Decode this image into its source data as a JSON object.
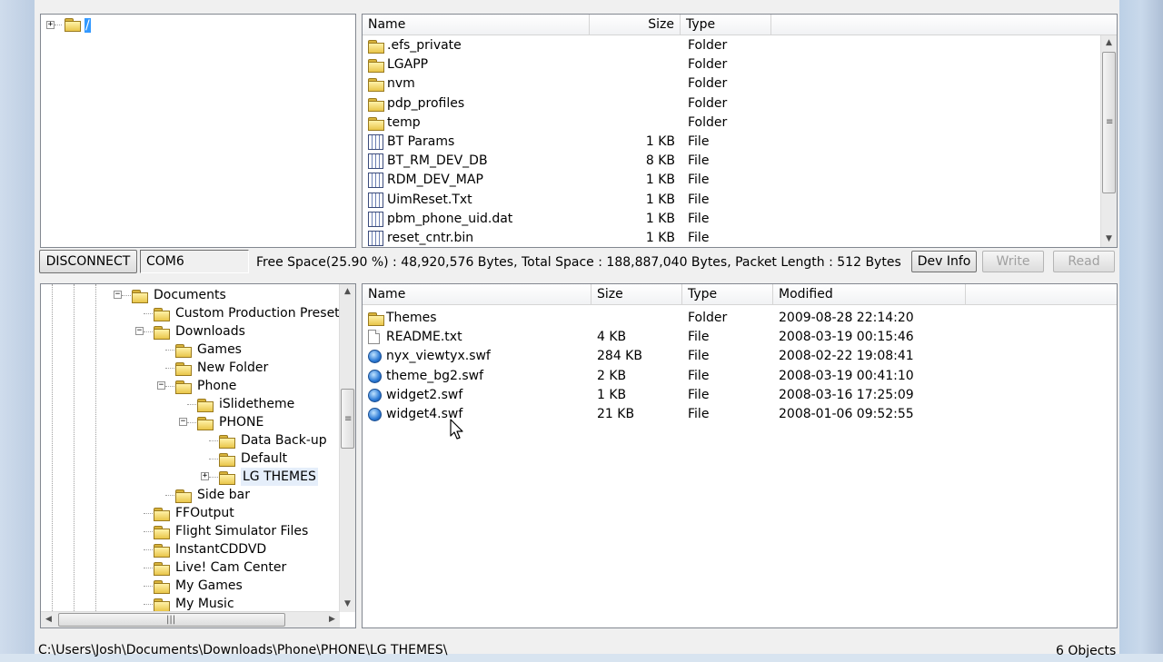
{
  "device_tree": {
    "root_label": "/"
  },
  "device_list": {
    "columns": [
      "Name",
      "Size",
      "Type"
    ],
    "rows": [
      {
        "name": ".efs_private",
        "size": "",
        "type": "Folder",
        "icon": "folder-icon"
      },
      {
        "name": "LGAPP",
        "size": "",
        "type": "Folder",
        "icon": "folder-icon"
      },
      {
        "name": "nvm",
        "size": "",
        "type": "Folder",
        "icon": "folder-icon"
      },
      {
        "name": "pdp_profiles",
        "size": "",
        "type": "Folder",
        "icon": "folder-icon"
      },
      {
        "name": "temp",
        "size": "",
        "type": "Folder",
        "icon": "folder-icon"
      },
      {
        "name": "BT Params",
        "size": "1 KB",
        "type": "File",
        "icon": "system-file-icon"
      },
      {
        "name": "BT_RM_DEV_DB",
        "size": "8 KB",
        "type": "File",
        "icon": "system-file-icon"
      },
      {
        "name": "RDM_DEV_MAP",
        "size": "1 KB",
        "type": "File",
        "icon": "system-file-icon"
      },
      {
        "name": "UimReset.Txt",
        "size": "1 KB",
        "type": "File",
        "icon": "system-file-icon"
      },
      {
        "name": "pbm_phone_uid.dat",
        "size": "1 KB",
        "type": "File",
        "icon": "system-file-icon"
      },
      {
        "name": "reset_cntr.bin",
        "size": "1 KB",
        "type": "File",
        "icon": "system-file-icon"
      }
    ]
  },
  "status_bar": {
    "disconnect_label": "DISCONNECT",
    "port": "COM6",
    "space_info": "Free Space(25.90 %) : 48,920,576 Bytes, Total Space : 188,887,040 Bytes, Packet Length : 512 Bytes",
    "dev_info_label": "Dev Info",
    "write_label": "Write",
    "read_label": "Read"
  },
  "pc_tree": {
    "nodes": [
      {
        "label": "Documents",
        "level": 0,
        "expander": "minus"
      },
      {
        "label": "Custom Production Preset",
        "level": 1,
        "expander": ""
      },
      {
        "label": "Downloads",
        "level": 1,
        "expander": "minus"
      },
      {
        "label": "Games",
        "level": 2,
        "expander": ""
      },
      {
        "label": "New Folder",
        "level": 2,
        "expander": ""
      },
      {
        "label": "Phone",
        "level": 2,
        "expander": "minus"
      },
      {
        "label": "iSlidetheme",
        "level": 3,
        "expander": ""
      },
      {
        "label": "PHONE",
        "level": 3,
        "expander": "minus"
      },
      {
        "label": "Data Back-up",
        "level": 4,
        "expander": ""
      },
      {
        "label": "Default",
        "level": 4,
        "expander": ""
      },
      {
        "label": "LG THEMES",
        "level": 4,
        "expander": "plus",
        "selected": true
      },
      {
        "label": "Side bar",
        "level": 2,
        "expander": ""
      },
      {
        "label": "FFOutput",
        "level": 1,
        "expander": ""
      },
      {
        "label": "Flight Simulator Files",
        "level": 1,
        "expander": ""
      },
      {
        "label": "InstantCDDVD",
        "level": 1,
        "expander": ""
      },
      {
        "label": "Live! Cam Center",
        "level": 1,
        "expander": ""
      },
      {
        "label": "My Games",
        "level": 1,
        "expander": ""
      },
      {
        "label": "My Music",
        "level": 1,
        "expander": ""
      }
    ]
  },
  "pc_list": {
    "columns": [
      "Name",
      "Size",
      "Type",
      "Modified"
    ],
    "rows": [
      {
        "name": "Themes",
        "size": "",
        "type": "Folder",
        "modified": "2009-08-28 22:14:20",
        "icon": "folder-icon"
      },
      {
        "name": "README.txt",
        "size": "4 KB",
        "type": "File",
        "modified": "2008-03-19 00:15:46",
        "icon": "text-file-icon"
      },
      {
        "name": "nyx_viewtyx.swf",
        "size": "284 KB",
        "type": "File",
        "modified": "2008-02-22 19:08:41",
        "icon": "swf-file-icon"
      },
      {
        "name": "theme_bg2.swf",
        "size": "2 KB",
        "type": "File",
        "modified": "2008-03-19 00:41:10",
        "icon": "swf-file-icon"
      },
      {
        "name": "widget2.swf",
        "size": "1 KB",
        "type": "File",
        "modified": "2008-03-16 17:25:09",
        "icon": "swf-file-icon"
      },
      {
        "name": "widget4.swf",
        "size": "21 KB",
        "type": "File",
        "modified": "2008-01-06 09:52:55",
        "icon": "swf-file-icon"
      }
    ]
  },
  "footer": {
    "path": "C:\\Users\\Josh\\Documents\\Downloads\\Phone\\PHONE\\LG THEMES\\",
    "object_count": "6 Objects"
  }
}
